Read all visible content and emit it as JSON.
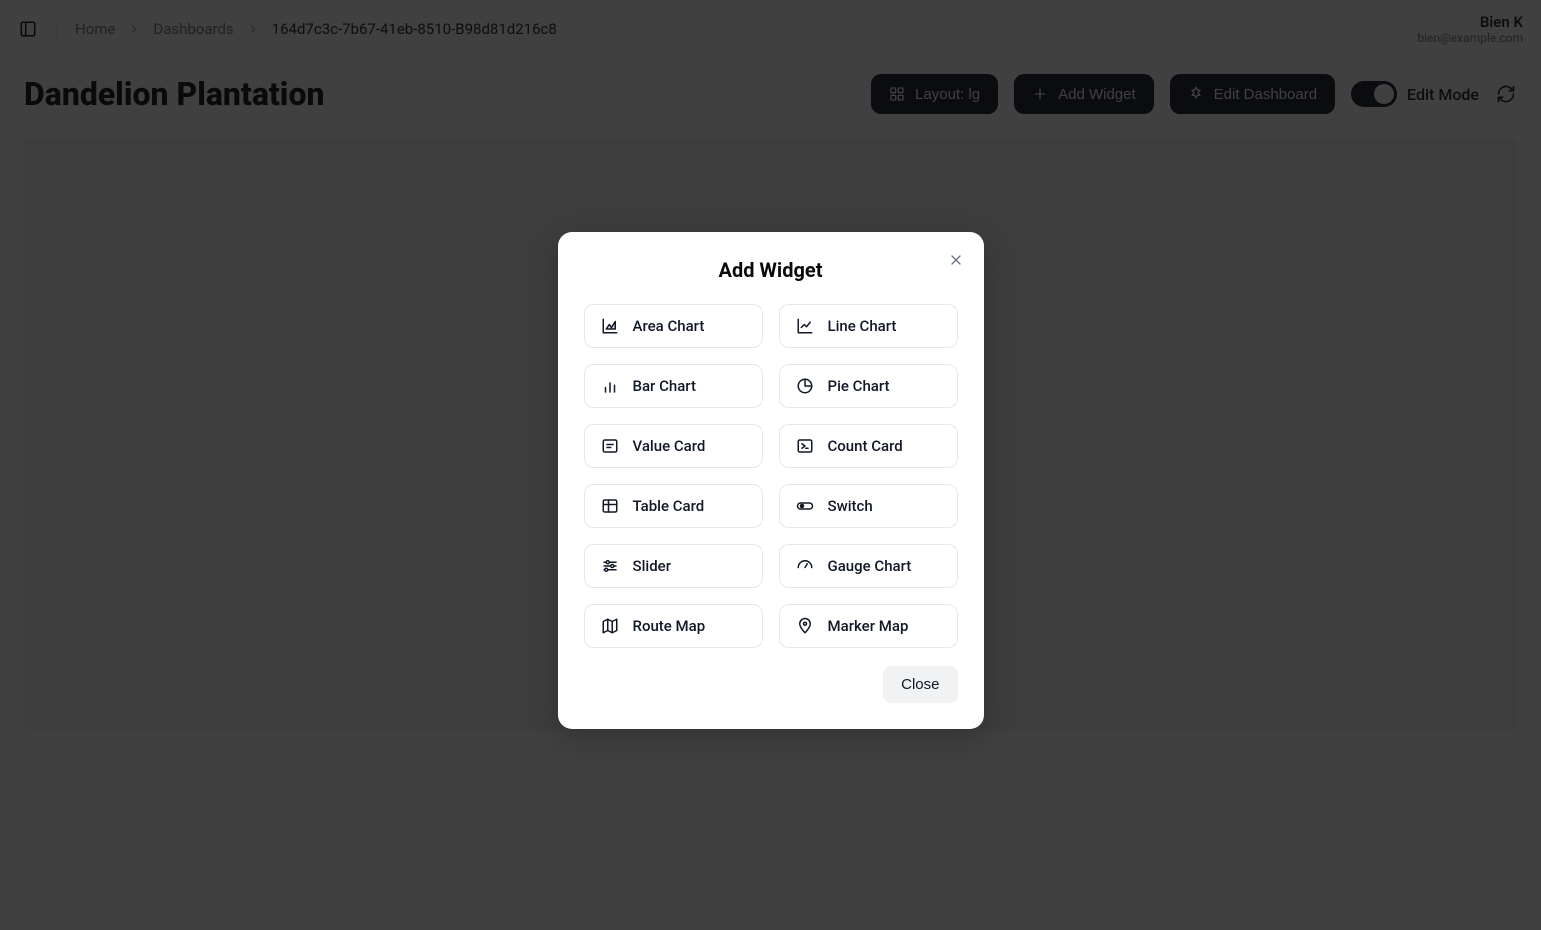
{
  "breadcrumb": {
    "items": [
      "Home",
      "Dashboards",
      "164d7c3c-7b67-41eb-8510-B98d81d216c8"
    ]
  },
  "user": {
    "name": "Bien K",
    "email": "bien@example.com"
  },
  "page": {
    "title": "Dandelion Plantation"
  },
  "actions": {
    "layout_label": "Layout: lg",
    "add_widget_label": "Add Widget",
    "edit_dashboard_label": "Edit Dashboard",
    "edit_mode_label": "Edit Mode"
  },
  "modal": {
    "title": "Add Widget",
    "close_label": "Close",
    "options": [
      {
        "label": "Area Chart",
        "icon": "area-chart-icon"
      },
      {
        "label": "Line Chart",
        "icon": "line-chart-icon"
      },
      {
        "label": "Bar Chart",
        "icon": "bar-chart-icon"
      },
      {
        "label": "Pie Chart",
        "icon": "pie-chart-icon"
      },
      {
        "label": "Value Card",
        "icon": "value-card-icon"
      },
      {
        "label": "Count Card",
        "icon": "count-card-icon"
      },
      {
        "label": "Table Card",
        "icon": "table-icon"
      },
      {
        "label": "Switch",
        "icon": "switch-icon"
      },
      {
        "label": "Slider",
        "icon": "slider-icon"
      },
      {
        "label": "Gauge Chart",
        "icon": "gauge-icon"
      },
      {
        "label": "Route Map",
        "icon": "route-map-icon"
      },
      {
        "label": "Marker Map",
        "icon": "marker-map-icon"
      }
    ]
  }
}
